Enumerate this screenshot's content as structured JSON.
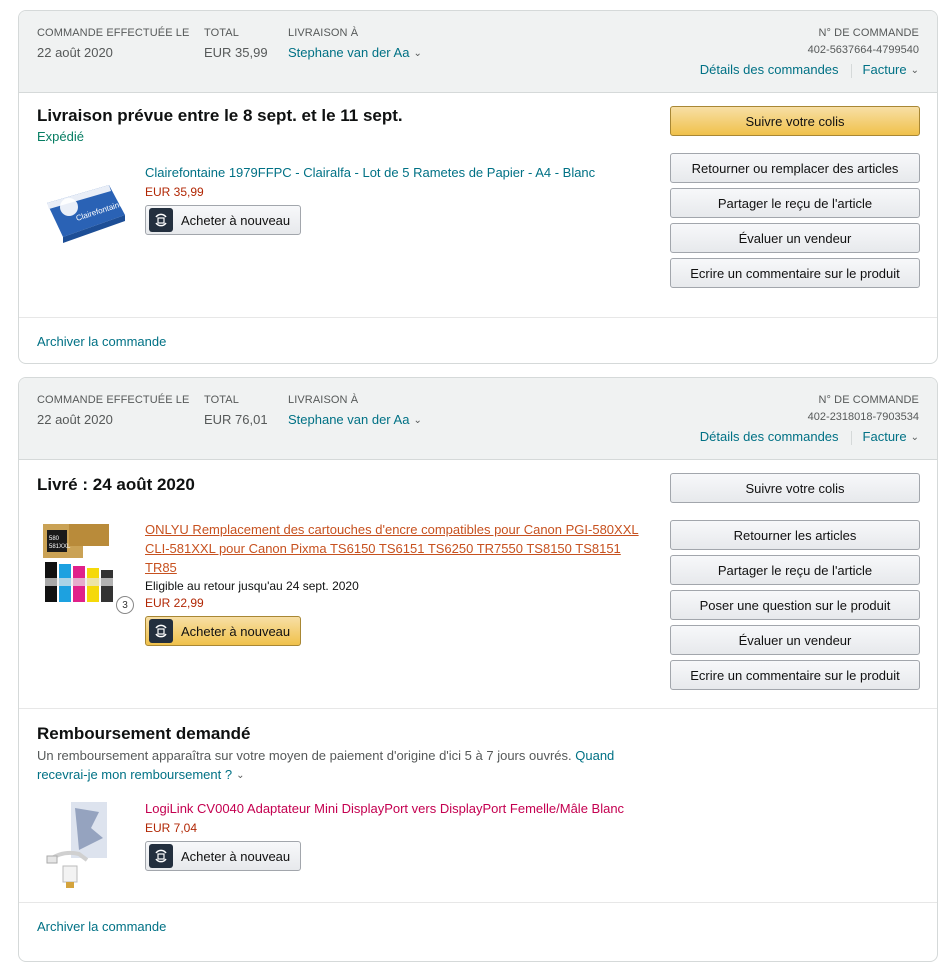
{
  "orders": [
    {
      "placed_label": "COMMANDE EFFECTUÉE LE",
      "placed_date": "22 août 2020",
      "total_label": "TOTAL",
      "total_value": "EUR 35,99",
      "ship_label": "LIVRAISON À",
      "ship_name": "Stephane van der Aa",
      "order_num_label": "N° DE COMMANDE",
      "order_num": "402-5637664-4799540",
      "details_link": "Détails des commandes",
      "invoice_link": "Facture",
      "shipment_title": "Livraison prévue entre le 8 sept. et le 11 sept.",
      "shipment_status": "Expédié",
      "item_title": "Clairefontaine 1979FFPC - Clairalfa - Lot de 5 Rametes de Papier - A4 - Blanc",
      "item_price": "EUR 35,99",
      "buy_again": "Acheter à nouveau",
      "buttons": [
        "Suivre votre colis",
        "Retourner ou remplacer des articles",
        "Partager le reçu de l'article",
        "Évaluer un vendeur",
        "Ecrire un commentaire sur le produit"
      ],
      "archive": "Archiver la commande"
    },
    {
      "placed_label": "COMMANDE EFFECTUÉE LE",
      "placed_date": "22 août 2020",
      "total_label": "TOTAL",
      "total_value": "EUR 76,01",
      "ship_label": "LIVRAISON À",
      "ship_name": "Stephane van der Aa",
      "order_num_label": "N° DE COMMANDE",
      "order_num": "402-2318018-7903534",
      "details_link": "Détails des commandes",
      "invoice_link": "Facture",
      "shipment_title": "Livré : 24 août 2020",
      "item_title": "ONLYU Remplacement des cartouches d'encre compatibles pour Canon PGI-580XXL CLI-581XXL pour Canon Pixma TS6150 TS6151 TS6250 TR7550 TS8150 TS8151 TR85",
      "item_note": "Eligible au retour jusqu'au 24 sept. 2020",
      "item_price": "EUR 22,99",
      "item_qty": "3",
      "buy_again": "Acheter à nouveau",
      "buttons": [
        "Suivre votre colis",
        "Retourner les articles",
        "Partager le reçu de l'article",
        "Poser une question sur le produit",
        "Évaluer un vendeur",
        "Ecrire un commentaire sur le produit"
      ],
      "refund_title": "Remboursement demandé",
      "refund_text": "Un remboursement apparaîtra sur votre moyen de paiement d'origine d'ici 5 à 7 jours ouvrés.",
      "refund_link": "Quand recevrai-je mon remboursement ?",
      "refund_item_title": "LogiLink CV0040 Adaptateur Mini DisplayPort vers DisplayPort Femelle/Mâle Blanc",
      "refund_item_price": "EUR 7,04",
      "refund_buy_again": "Acheter à nouveau",
      "archive": "Archiver la commande"
    }
  ],
  "colors": {
    "link": "#007185",
    "price": "#b12704",
    "shipped": "#067d62",
    "primary_button": "#f0c14b"
  }
}
